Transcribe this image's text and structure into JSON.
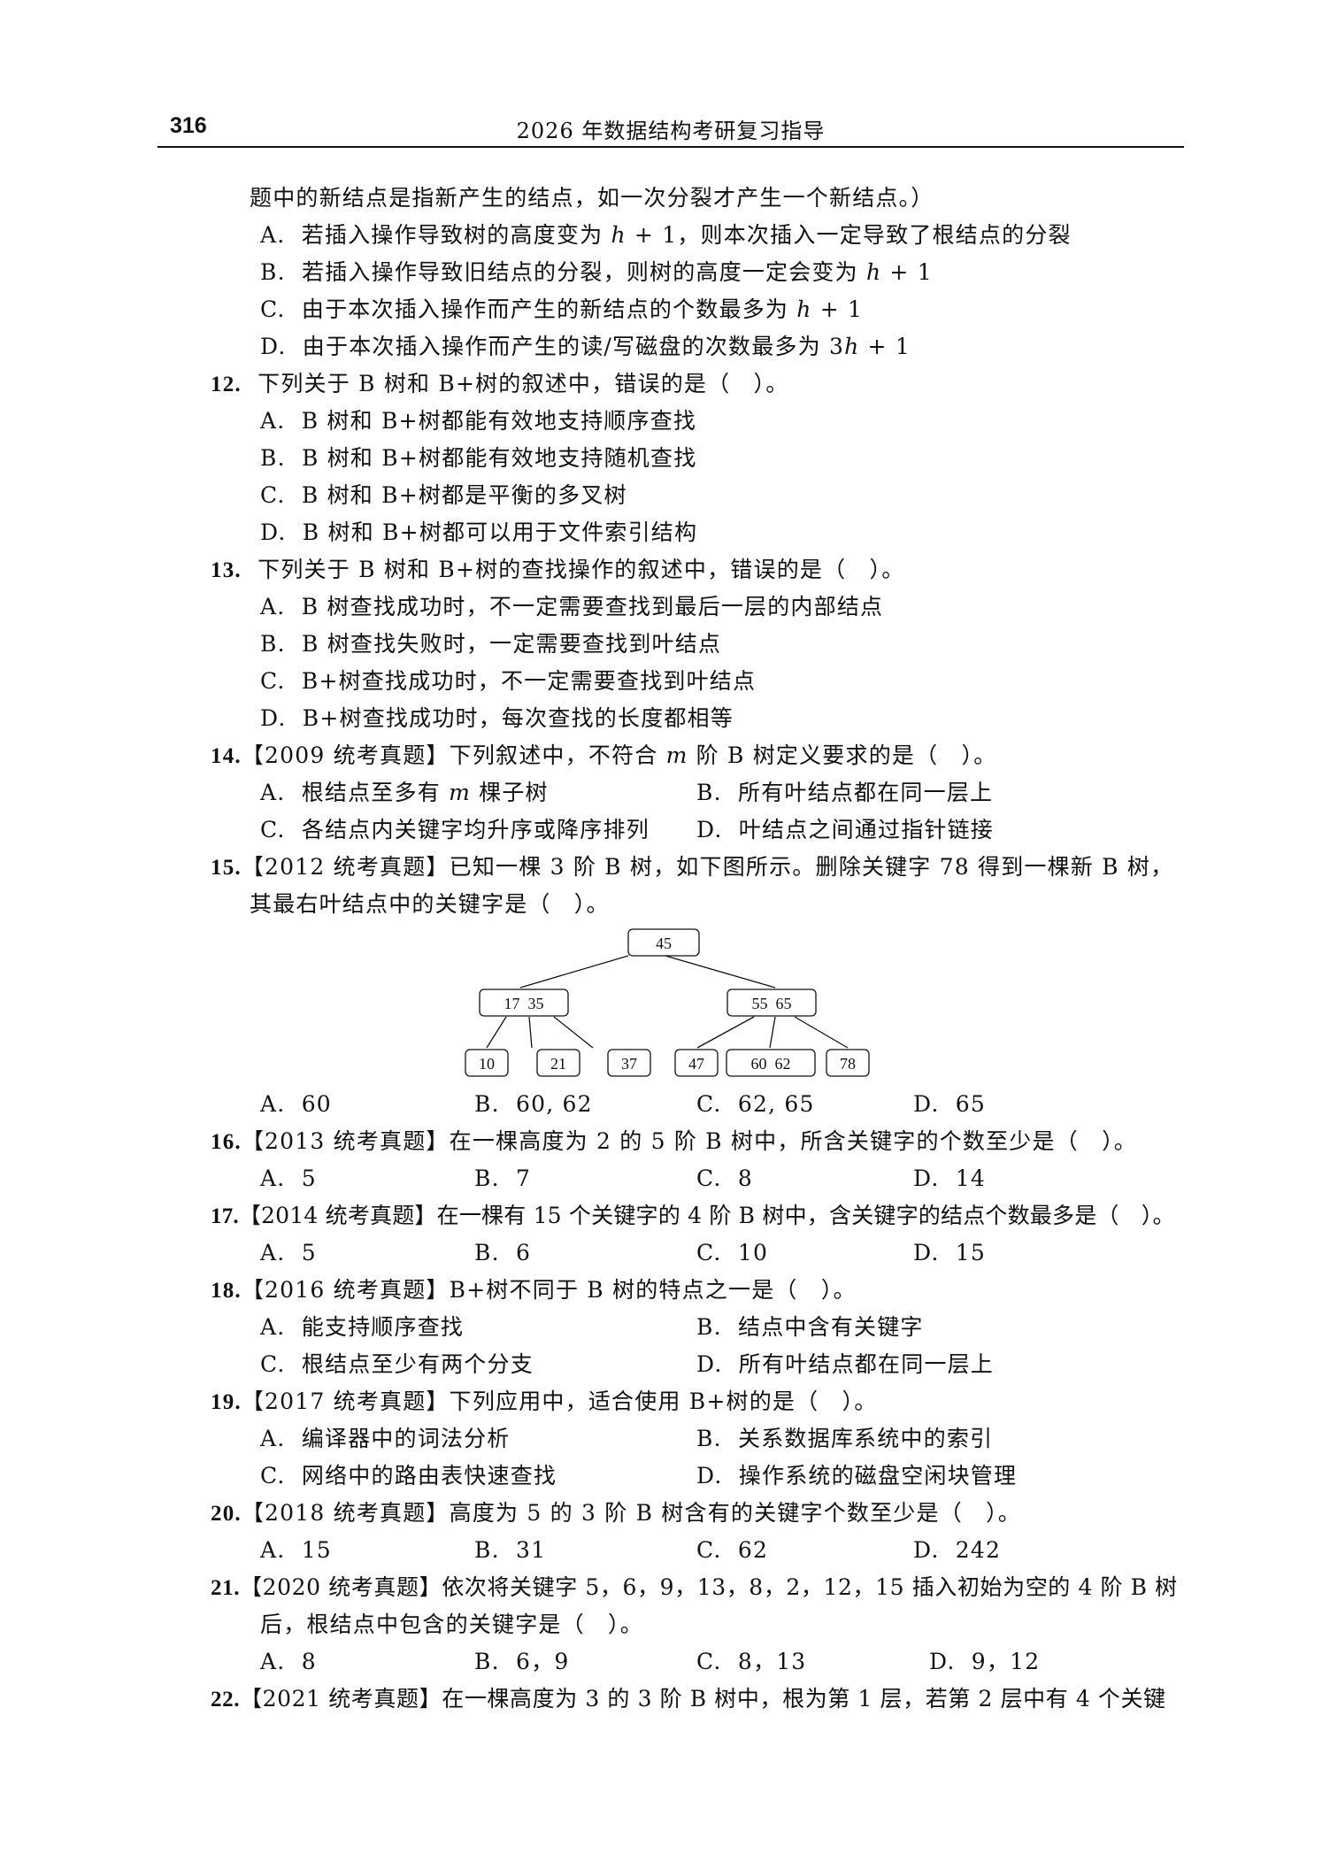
{
  "header": {
    "page_number": "316",
    "title": "2026 年数据结构考研复习指导"
  },
  "q11": {
    "continuation": "题中的新结点是指新产生的结点，如一次分裂才产生一个新结点。）",
    "options": [
      {
        "letter": "A.",
        "pre": "若插入操作导致树的高度变为 ",
        "var": "h",
        "post": " + 1，则本次插入一定导致了根结点的分裂"
      },
      {
        "letter": "B.",
        "pre": "若插入操作导致旧结点的分裂，则树的高度一定会变为 ",
        "var": "h",
        "post": " + 1"
      },
      {
        "letter": "C.",
        "pre": "由于本次插入操作而产生的新结点的个数最多为 ",
        "var": "h",
        "post": " + 1"
      },
      {
        "letter": "D.",
        "pre": "由于本次插入操作而产生的读/写磁盘的次数最多为 3",
        "var": "h",
        "post": " + 1"
      }
    ]
  },
  "q12": {
    "number": "12.",
    "stem": "下列关于 B 树和 B+树的叙述中，错误的是（　）。",
    "options": [
      {
        "letter": "A.",
        "text": "B 树和 B+树都能有效地支持顺序查找"
      },
      {
        "letter": "B.",
        "text": "B 树和 B+树都能有效地支持随机查找"
      },
      {
        "letter": "C.",
        "text": "B 树和 B+树都是平衡的多叉树"
      },
      {
        "letter": "D.",
        "text": "B 树和 B+树都可以用于文件索引结构"
      }
    ]
  },
  "q13": {
    "number": "13.",
    "stem": "下列关于 B 树和 B+树的查找操作的叙述中，错误的是（　）。",
    "options": [
      {
        "letter": "A.",
        "text": "B 树查找成功时，不一定需要查找到最后一层的内部结点"
      },
      {
        "letter": "B.",
        "text": "B 树查找失败时，一定需要查找到叶结点"
      },
      {
        "letter": "C.",
        "text": "B+树查找成功时，不一定需要查找到叶结点"
      },
      {
        "letter": "D.",
        "text": "B+树查找成功时，每次查找的长度都相等"
      }
    ]
  },
  "q14": {
    "number": "14.",
    "stem_pre": "【2009 统考真题】下列叙述中，不符合 ",
    "stem_var": "m",
    "stem_post": " 阶 B 树定义要求的是（　）。",
    "options": [
      {
        "letter": "A.",
        "pre": "根结点至多有 ",
        "var": "m",
        "post": " 棵子树"
      },
      {
        "letter": "B.",
        "text": "所有叶结点都在同一层上"
      },
      {
        "letter": "C.",
        "text": "各结点内关键字均升序或降序排列"
      },
      {
        "letter": "D.",
        "text": "叶结点之间通过指针链接"
      }
    ]
  },
  "q15": {
    "number": "15.",
    "stem1": "【2012 统考真题】已知一棵 3 阶 B 树，如下图所示。删除关键字 78 得到一棵新 B 树，",
    "stem2": "其最右叶结点中的关键字是（　）。",
    "tree": {
      "root": "45",
      "level2": [
        "17  35",
        "55  65"
      ],
      "leaves": [
        "10",
        "21",
        "37",
        "47",
        "60  62",
        "78"
      ]
    },
    "options": [
      {
        "letter": "A.",
        "text": "60"
      },
      {
        "letter": "B.",
        "text": "60, 62"
      },
      {
        "letter": "C.",
        "text": "62, 65"
      },
      {
        "letter": "D.",
        "text": "65"
      }
    ]
  },
  "q16": {
    "number": "16.",
    "stem": "【2013 统考真题】在一棵高度为 2 的 5 阶 B 树中，所含关键字的个数至少是（　）。",
    "options": [
      {
        "letter": "A.",
        "text": "5"
      },
      {
        "letter": "B.",
        "text": "7"
      },
      {
        "letter": "C.",
        "text": "8"
      },
      {
        "letter": "D.",
        "text": "14"
      }
    ]
  },
  "q17": {
    "number": "17.",
    "stem": "【2014 统考真题】在一棵有 15 个关键字的 4 阶 B 树中，含关键字的结点个数最多是（　）。",
    "options": [
      {
        "letter": "A.",
        "text": "5"
      },
      {
        "letter": "B.",
        "text": "6"
      },
      {
        "letter": "C.",
        "text": "10"
      },
      {
        "letter": "D.",
        "text": "15"
      }
    ]
  },
  "q18": {
    "number": "18.",
    "stem": "【2016 统考真题】B+树不同于 B 树的特点之一是（　）。",
    "options": [
      {
        "letter": "A.",
        "text": "能支持顺序查找"
      },
      {
        "letter": "B.",
        "text": "结点中含有关键字"
      },
      {
        "letter": "C.",
        "text": "根结点至少有两个分支"
      },
      {
        "letter": "D.",
        "text": "所有叶结点都在同一层上"
      }
    ]
  },
  "q19": {
    "number": "19.",
    "stem": "【2017 统考真题】下列应用中，适合使用 B+树的是（　）。",
    "options": [
      {
        "letter": "A.",
        "text": "编译器中的词法分析"
      },
      {
        "letter": "B.",
        "text": "关系数据库系统中的索引"
      },
      {
        "letter": "C.",
        "text": "网络中的路由表快速查找"
      },
      {
        "letter": "D.",
        "text": "操作系统的磁盘空闲块管理"
      }
    ]
  },
  "q20": {
    "number": "20.",
    "stem": "【2018 统考真题】高度为 5 的 3 阶 B 树含有的关键字个数至少是（　）。",
    "options": [
      {
        "letter": "A.",
        "text": "15"
      },
      {
        "letter": "B.",
        "text": "31"
      },
      {
        "letter": "C.",
        "text": "62"
      },
      {
        "letter": "D.",
        "text": "242"
      }
    ]
  },
  "q21": {
    "number": "21.",
    "stem1": "【2020 统考真题】依次将关键字 5，6，9，13，8，2，12，15 插入初始为空的 4 阶 B 树",
    "stem2": "后，根结点中包含的关键字是（　）。",
    "options": [
      {
        "letter": "A.",
        "text": "8"
      },
      {
        "letter": "B.",
        "text": "6，9"
      },
      {
        "letter": "C.",
        "text": "8，13"
      },
      {
        "letter": "D.",
        "text": "9，12"
      }
    ]
  },
  "q22": {
    "number": "22.",
    "stem": "【2021 统考真题】在一棵高度为 3 的 3 阶 B 树中，根为第 1 层，若第 2 层中有 4 个关键"
  }
}
